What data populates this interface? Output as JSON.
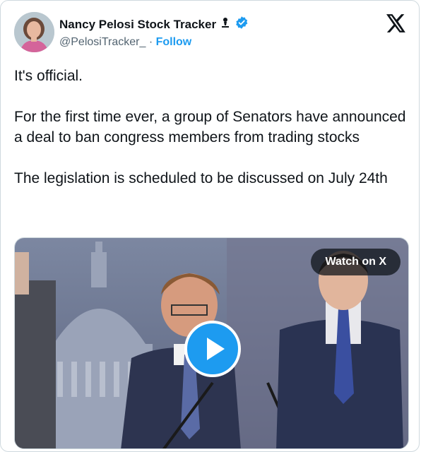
{
  "tweet": {
    "author_name": "Nancy Pelosi Stock Tracker",
    "handle": "@PelosiTracker_",
    "separator": "·",
    "follow_label": "Follow",
    "paragraphs": [
      "It's official.",
      "For the first time ever, a group of Senators have announced a deal to ban congress members from trading stocks",
      "The legislation is scheduled to be discussed on July 24th"
    ]
  },
  "media": {
    "watch_label": "Watch on X"
  },
  "icons": {
    "verified": "verified-badge-icon",
    "affiliate": "person-badge-icon",
    "platform": "x-logo-icon",
    "play": "play-icon"
  },
  "colors": {
    "accent": "#1d9bf0",
    "text": "#0f1419",
    "muted": "#536471"
  }
}
